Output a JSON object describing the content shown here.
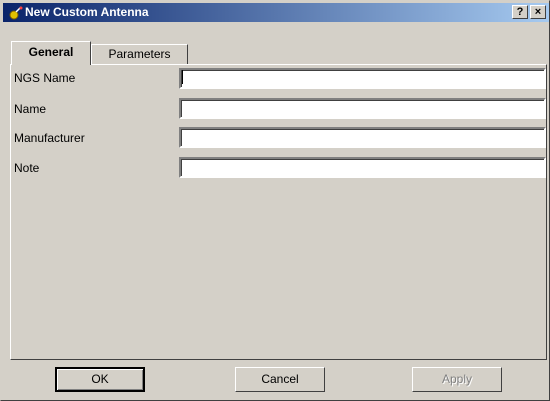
{
  "window": {
    "title": "New Custom Antenna",
    "help_label": "?",
    "close_label": "×"
  },
  "tabs": [
    {
      "label": "General",
      "active": true
    },
    {
      "label": "Parameters",
      "active": false
    }
  ],
  "fields": [
    {
      "label": "NGS Name",
      "value": ""
    },
    {
      "label": "Name",
      "value": ""
    },
    {
      "label": "Manufacturer",
      "value": ""
    },
    {
      "label": "Note",
      "value": ""
    }
  ],
  "buttons": {
    "ok": "OK",
    "cancel": "Cancel",
    "apply": "Apply"
  }
}
